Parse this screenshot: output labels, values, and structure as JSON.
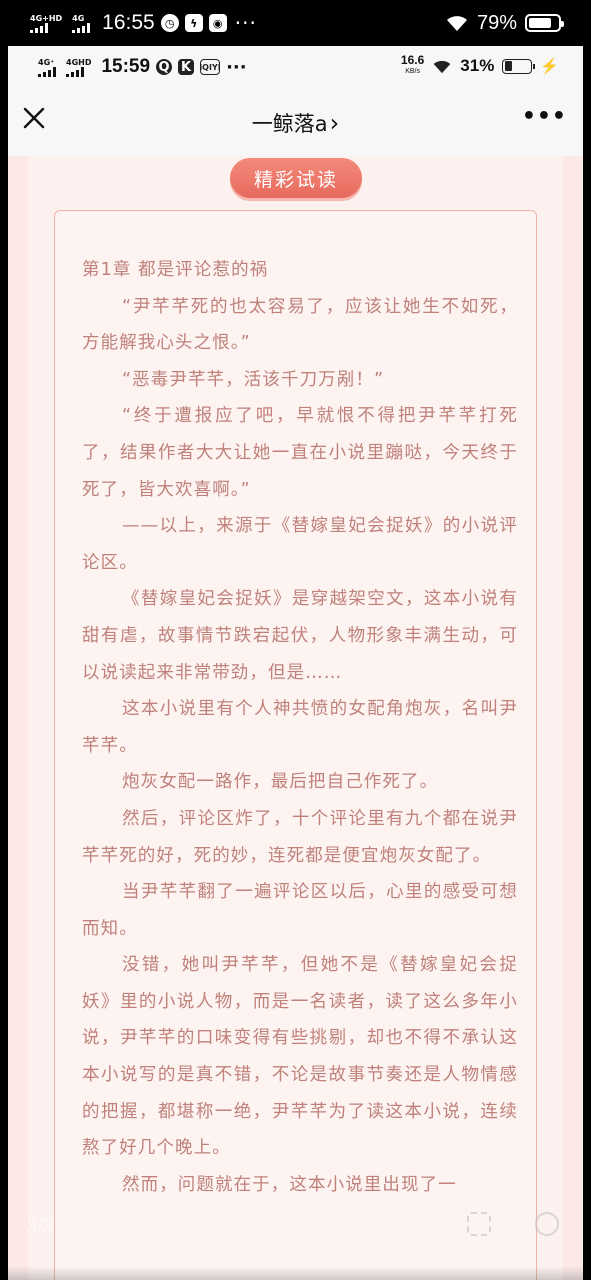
{
  "outer_status": {
    "network_1": "4G+HD",
    "network_2": "4G",
    "time": "16:55",
    "app_icons": [
      "clock-app",
      "bolt-app",
      "dianping-app"
    ],
    "more": "···",
    "wifi": "wifi-icon",
    "battery_percent": "79%",
    "battery_level": 0.79
  },
  "inner_status": {
    "network_1": "4G⁺",
    "network_2": "4GHD",
    "time": "15:59",
    "app_icons": [
      "Q",
      "K",
      "iQIYI"
    ],
    "more": "···",
    "speed_value": "16.6",
    "speed_unit": "KB/s",
    "battery_percent": "31%",
    "battery_level": 0.31,
    "charging": "⚡"
  },
  "nav": {
    "title": "一鲸落a",
    "title_chevron": "›",
    "more": "•••"
  },
  "reader": {
    "badge": "精彩试读",
    "paragraphs": [
      {
        "text": "第1章 都是评论惹的祸",
        "indent": false
      },
      {
        "text": "“尹芊芊死的也太容易了，应该让她生不如死，方能解我心头之恨。”",
        "indent": true
      },
      {
        "text": "“恶毒尹芊芊，活该千刀万剐！”",
        "indent": true
      },
      {
        "text": "“终于遭报应了吧，早就恨不得把尹芊芊打死了，结果作者大大让她一直在小说里蹦哒，今天终于死了，皆大欢喜啊。”",
        "indent": true
      },
      {
        "text": "——以上，来源于《替嫁皇妃会捉妖》的小说评论区。",
        "indent": true
      },
      {
        "text": "《替嫁皇妃会捉妖》是穿越架空文，这本小说有甜有虐，故事情节跌宕起伏，人物形象丰满生动，可以说读起来非常带劲，但是……",
        "indent": true
      },
      {
        "text": "这本小说里有个人神共愤的女配角炮灰，名叫尹芊芊。",
        "indent": true
      },
      {
        "text": "炮灰女配一路作，最后把自己作死了。",
        "indent": true
      },
      {
        "text": "然后，评论区炸了，十个评论里有九个都在说尹芊芊死的好，死的妙，连死都是便宜炮灰女配了。",
        "indent": true
      },
      {
        "text": "当尹芊芊翻了一遍评论区以后，心里的感受可想而知。",
        "indent": true
      },
      {
        "text": "没错，她叫尹芊芊，但她不是《替嫁皇妃会捉妖》里的小说人物，而是一名读者，读了这么多年小说，尹芊芊的口味变得有些挑剔，却也不得不承认这本小说写的是真不错，不论是故事节奏还是人物情感的把握，都堪称一绝，尹芊芊为了读这本小说，连续熬了好几个晚上。",
        "indent": true
      },
      {
        "text": "然而，问题就在于，这本小说里出现了一",
        "indent": true
      }
    ]
  },
  "viewer": {
    "page_counter": "3/3"
  }
}
